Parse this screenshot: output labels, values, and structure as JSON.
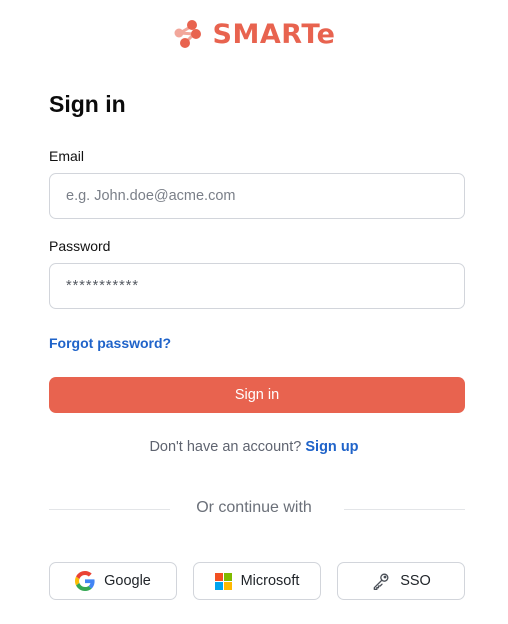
{
  "brand": {
    "name": "SMARTe",
    "accent_color": "#E8634F",
    "logo_icon": "connected-dots-logo"
  },
  "page_title": "Sign in",
  "email": {
    "label": "Email",
    "placeholder": "e.g. John.doe@acme.com",
    "value": ""
  },
  "password": {
    "label": "Password",
    "placeholder": "***********",
    "value": ""
  },
  "forgot_password": {
    "label": "Forgot password?"
  },
  "sign_in_button": {
    "label": "Sign in"
  },
  "signup": {
    "prompt": "Don't have an account?",
    "link_label": "Sign up"
  },
  "divider": {
    "label": "Or continue with"
  },
  "social": [
    {
      "label": "Google",
      "icon": "google-icon"
    },
    {
      "label": "Microsoft",
      "icon": "microsoft-icon"
    },
    {
      "label": "SSO",
      "icon": "key-icon"
    }
  ],
  "colors": {
    "accent": "#E8634F",
    "link": "#1F63C9",
    "border": "#D2D5DB",
    "muted_text": "#5F6470"
  }
}
